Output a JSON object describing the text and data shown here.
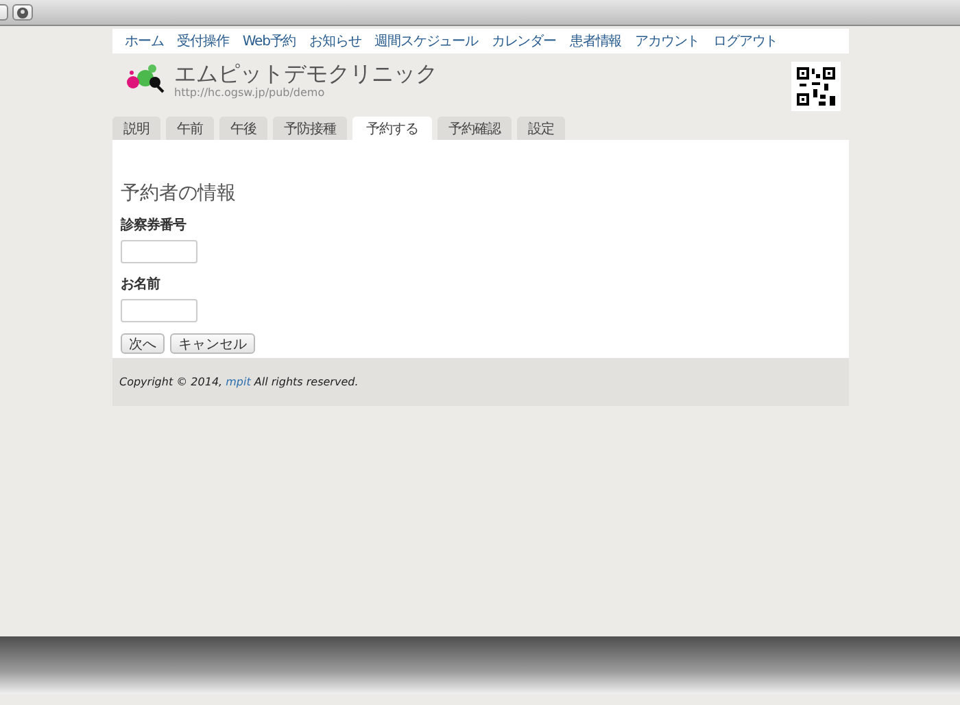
{
  "nav": [
    {
      "label": "ホーム"
    },
    {
      "label": "受付操作"
    },
    {
      "label": "Web予約"
    },
    {
      "label": "お知らせ"
    },
    {
      "label": "週間スケジュール"
    },
    {
      "label": "カレンダー"
    },
    {
      "label": "患者情報"
    },
    {
      "label": "アカウント"
    },
    {
      "label": "ログアウト"
    }
  ],
  "site": {
    "title": "エムピットデモクリニック",
    "url": "http://hc.ogsw.jp/pub/demo"
  },
  "tabs": [
    {
      "label": "説明",
      "selected": false
    },
    {
      "label": "午前",
      "selected": false
    },
    {
      "label": "午後",
      "selected": false
    },
    {
      "label": "予防接種",
      "selected": false
    },
    {
      "label": "予約する",
      "selected": true
    },
    {
      "label": "予約確認",
      "selected": false
    },
    {
      "label": "設定",
      "selected": false
    }
  ],
  "form": {
    "heading": "予約者の情報",
    "fields": [
      {
        "label": "診察券番号"
      },
      {
        "label": "お名前"
      }
    ],
    "buttons": [
      "次へ",
      "キャンセル"
    ]
  },
  "footer": {
    "before": "Copyright © 2014, ",
    "link": "mpit",
    "after": " All rights reserved."
  }
}
